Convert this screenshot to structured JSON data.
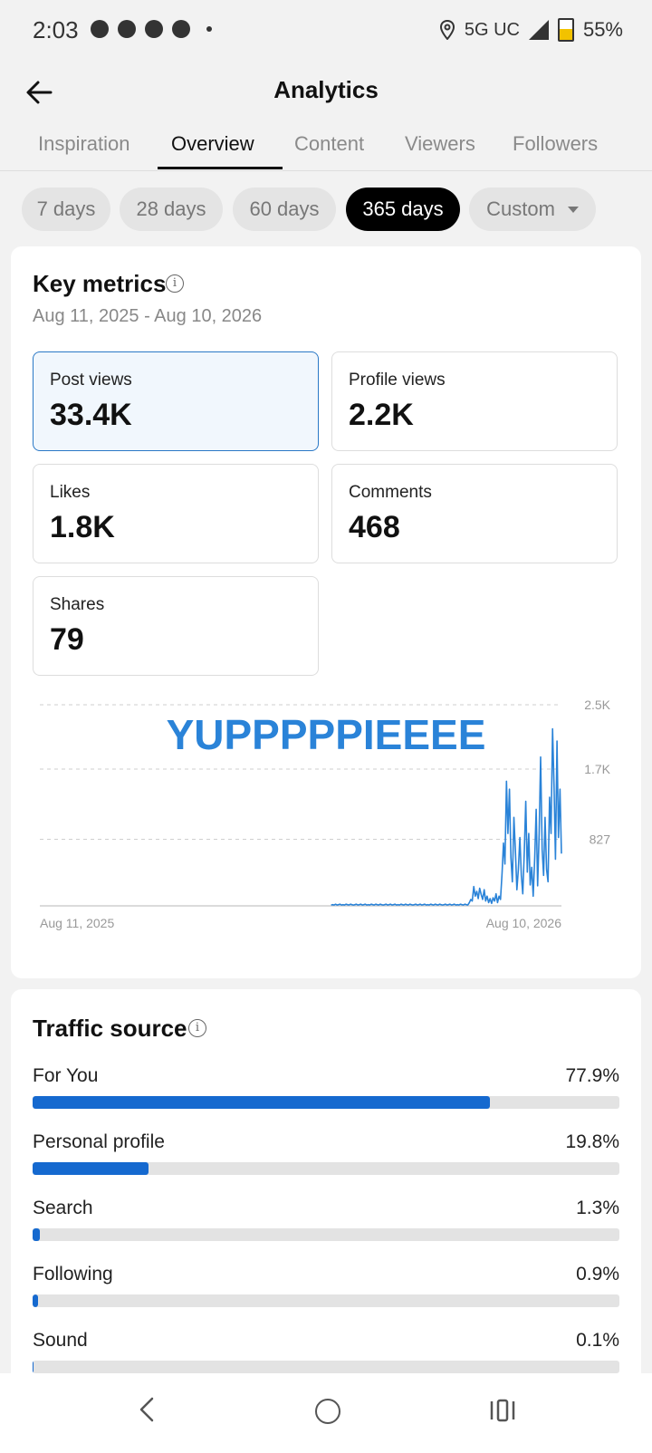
{
  "status": {
    "time": "2:03",
    "network": "5G UC",
    "battery": "55%"
  },
  "header": {
    "title": "Analytics",
    "back_icon": "arrow-left-icon"
  },
  "tabs": [
    {
      "label": "Inspiration",
      "active": false
    },
    {
      "label": "Overview",
      "active": true
    },
    {
      "label": "Content",
      "active": false
    },
    {
      "label": "Viewers",
      "active": false
    },
    {
      "label": "Followers",
      "active": false
    }
  ],
  "date_filters": [
    {
      "label": "7 days",
      "active": false
    },
    {
      "label": "28 days",
      "active": false
    },
    {
      "label": "60 days",
      "active": false
    },
    {
      "label": "365 days",
      "active": true
    },
    {
      "label": "Custom",
      "active": false
    }
  ],
  "key_metrics": {
    "title": "Key metrics",
    "date_range": "Aug 11, 2025 - Aug 10, 2026",
    "metrics": [
      {
        "label": "Post views",
        "value": "33.4K",
        "selected": true
      },
      {
        "label": "Profile views",
        "value": "2.2K",
        "selected": false
      },
      {
        "label": "Likes",
        "value": "1.8K",
        "selected": false
      },
      {
        "label": "Comments",
        "value": "468",
        "selected": false
      },
      {
        "label": "Shares",
        "value": "79",
        "selected": false
      }
    ]
  },
  "chart_data": {
    "type": "line",
    "title": "",
    "xlabel": "",
    "ylabel": "",
    "x_tick_labels": [
      "Aug 11, 2025",
      "Aug 10, 2026"
    ],
    "y_tick_labels": [
      "2.5K",
      "1.7K",
      "827"
    ],
    "y_ticks": [
      2500,
      1700,
      827
    ],
    "ylim": [
      0,
      2500
    ],
    "grid": true,
    "line_color": "#2a83d8",
    "annotation": "YUPPPPPIEEEE",
    "series": [
      {
        "values": [
          0,
          0,
          0,
          0,
          0,
          0,
          0,
          0,
          0,
          0,
          0,
          0,
          0,
          0,
          0,
          0,
          0,
          0,
          0,
          0,
          0,
          0,
          0,
          0,
          0,
          0,
          0,
          0,
          0,
          0,
          0,
          0,
          0,
          0,
          0,
          0,
          0,
          0,
          0,
          0,
          0,
          0,
          0,
          0,
          0,
          0,
          0,
          0,
          0,
          0,
          0,
          0,
          0,
          0,
          0,
          0,
          0,
          0,
          0,
          0,
          0,
          0,
          0,
          0,
          0,
          0,
          0,
          0,
          0,
          0,
          0,
          0,
          0,
          0,
          0,
          0,
          0,
          0,
          0,
          0,
          0,
          0,
          0,
          0,
          0,
          0,
          0,
          0,
          0,
          0,
          0,
          0,
          0,
          0,
          0,
          0,
          0,
          0,
          0,
          0,
          0,
          0,
          0,
          0,
          0,
          0,
          0,
          0,
          0,
          0,
          0,
          0,
          0,
          0,
          0,
          0,
          0,
          0,
          0,
          0,
          0,
          0,
          0,
          0,
          0,
          0,
          0,
          0,
          0,
          0,
          0,
          0,
          0,
          0,
          0,
          0,
          0,
          0,
          0,
          0,
          0,
          0,
          0,
          0,
          0,
          0,
          0,
          0,
          0,
          0,
          0,
          0,
          0,
          0,
          0,
          0,
          0,
          0,
          0,
          0,
          0,
          0,
          0,
          0,
          0,
          0,
          0,
          0,
          0,
          0,
          0,
          0,
          0,
          0,
          0,
          0,
          0,
          0,
          0,
          0,
          0,
          0,
          0,
          0,
          0,
          0,
          0,
          0,
          0,
          0,
          0,
          0,
          0,
          0,
          0,
          0,
          10,
          15,
          10,
          20,
          10,
          15,
          20,
          10,
          15,
          10,
          20,
          15,
          10,
          20,
          15,
          10,
          15,
          20,
          10,
          15,
          20,
          10,
          15,
          20,
          10,
          15,
          10,
          20,
          15,
          10,
          20,
          15,
          10,
          20,
          15,
          10,
          15,
          20,
          10,
          15,
          20,
          10,
          15,
          20,
          10,
          15,
          10,
          20,
          15,
          10,
          20,
          15,
          10,
          20,
          15,
          10,
          15,
          20,
          10,
          15,
          20,
          10,
          15,
          20,
          10,
          15,
          10,
          20,
          15,
          10,
          20,
          15,
          10,
          20,
          15,
          10,
          15,
          20,
          10,
          15,
          20,
          10,
          15,
          20,
          10,
          15,
          10,
          20,
          15,
          10,
          20,
          15,
          10,
          40,
          80,
          60,
          240,
          120,
          180,
          90,
          220,
          140,
          80,
          200,
          60,
          120,
          40,
          90,
          30,
          100,
          60,
          150,
          40,
          120,
          80,
          400,
          780,
          520,
          1550,
          900,
          1450,
          600,
          300,
          1100,
          700,
          200,
          450,
          850,
          380,
          150,
          680,
          1300,
          420,
          900,
          260,
          480,
          120,
          600,
          1200,
          250,
          900,
          1850,
          700,
          380,
          1100,
          450,
          300,
          1350,
          900,
          2200,
          1500,
          580,
          2050,
          850,
          1450,
          650
        ]
      }
    ]
  },
  "traffic_source": {
    "title": "Traffic source",
    "items": [
      {
        "label": "For You",
        "pct_text": "77.9%",
        "pct": 77.9
      },
      {
        "label": "Personal profile",
        "pct_text": "19.8%",
        "pct": 19.8
      },
      {
        "label": "Search",
        "pct_text": "1.3%",
        "pct": 1.3
      },
      {
        "label": "Following",
        "pct_text": "0.9%",
        "pct": 0.9
      },
      {
        "label": "Sound",
        "pct_text": "0.1%",
        "pct": 0.1
      }
    ]
  },
  "colors": {
    "accent_blue": "#1569cf",
    "chart_line": "#2a83d8",
    "active_chip_bg": "#000000"
  }
}
